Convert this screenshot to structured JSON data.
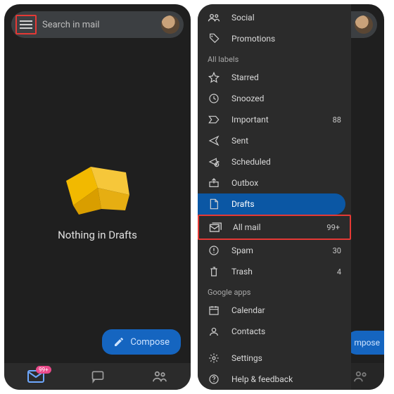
{
  "left": {
    "search_placeholder": "Search in mail",
    "empty_message": "Nothing in Drafts",
    "compose_label": "Compose",
    "bottom_badge": "99+"
  },
  "drawer": {
    "top_items": [
      {
        "icon": "social-icon",
        "label": "Social"
      },
      {
        "icon": "tag-icon",
        "label": "Promotions"
      }
    ],
    "section_all_labels": "All labels",
    "label_items": [
      {
        "icon": "star-icon",
        "label": "Starred",
        "count": ""
      },
      {
        "icon": "clock-icon",
        "label": "Snoozed",
        "count": ""
      },
      {
        "icon": "important-icon",
        "label": "Important",
        "count": "88"
      },
      {
        "icon": "send-icon",
        "label": "Sent",
        "count": ""
      },
      {
        "icon": "schedule-icon",
        "label": "Scheduled",
        "count": ""
      },
      {
        "icon": "outbox-icon",
        "label": "Outbox",
        "count": ""
      },
      {
        "icon": "file-icon",
        "label": "Drafts",
        "count": "",
        "selected": true
      },
      {
        "icon": "allmail-icon",
        "label": "All mail",
        "count": "99+",
        "highlight": true
      },
      {
        "icon": "spam-icon",
        "label": "Spam",
        "count": "30"
      },
      {
        "icon": "trash-icon",
        "label": "Trash",
        "count": "4"
      }
    ],
    "section_google_apps": "Google apps",
    "google_items": [
      {
        "icon": "calendar-icon",
        "label": "Calendar"
      },
      {
        "icon": "contacts-icon",
        "label": "Contacts"
      }
    ],
    "footer_items": [
      {
        "icon": "gear-icon",
        "label": "Settings"
      },
      {
        "icon": "help-icon",
        "label": "Help & feedback"
      }
    ]
  },
  "right_backdrop": {
    "compose_partial": "mpose"
  }
}
